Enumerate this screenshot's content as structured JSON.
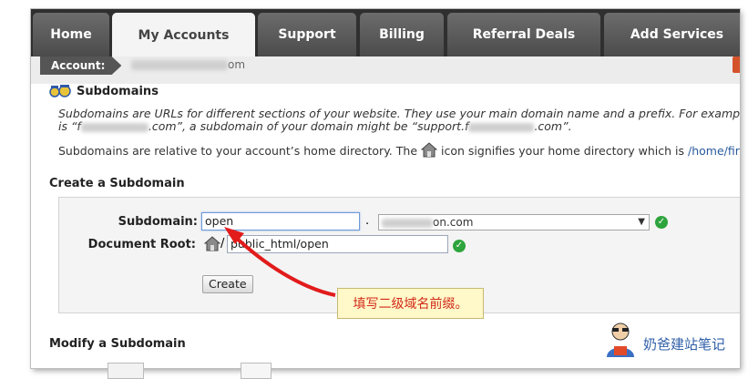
{
  "tabs": [
    {
      "label": "Home",
      "active": false
    },
    {
      "label": "My Accounts",
      "active": true
    },
    {
      "label": "Support",
      "active": false
    },
    {
      "label": "Billing",
      "active": false
    },
    {
      "label": "Referral Deals",
      "active": false
    },
    {
      "label": "Add Services",
      "active": false
    }
  ],
  "account": {
    "label": "Account:",
    "domain_suffix": "om"
  },
  "page": {
    "title": "Subdomains",
    "icon": "subdomain-icon"
  },
  "intro": {
    "line1": "Subdomains are URLs for different sections of your website. They use your main domain name and a prefix. For example, i",
    "line2_prefix": "is “f",
    "line2_mid": ".com”, a subdomain of your domain might be “support.f",
    "line2_end": ".com”."
  },
  "home_note": {
    "before": "Subdomains are relative to your account’s home directory. The",
    "after": "icon signifies your home directory which is",
    "path": "/home/firsts",
    "icon": "home-icon"
  },
  "create": {
    "heading": "Create a Subdomain",
    "subdomain_label": "Subdomain:",
    "subdomain_value": "open",
    "dot": ".",
    "domain_select_value": "on.com",
    "docroot_label": "Document Root:",
    "docroot_slash": "/",
    "docroot_value": "public_html/open",
    "create_button": "Create"
  },
  "modify": {
    "heading": "Modify a Subdomain"
  },
  "annotation": {
    "callout": "填写二级域名前缀。"
  },
  "watermark": {
    "text": "奶爸建站笔记"
  },
  "colors": {
    "tab_bg": "#5a5a5a",
    "active_tab": "#f4f4f4",
    "accent_path": "#2a5a9c",
    "check_green": "#2ea43c",
    "arrow_red": "#e21b1b"
  }
}
